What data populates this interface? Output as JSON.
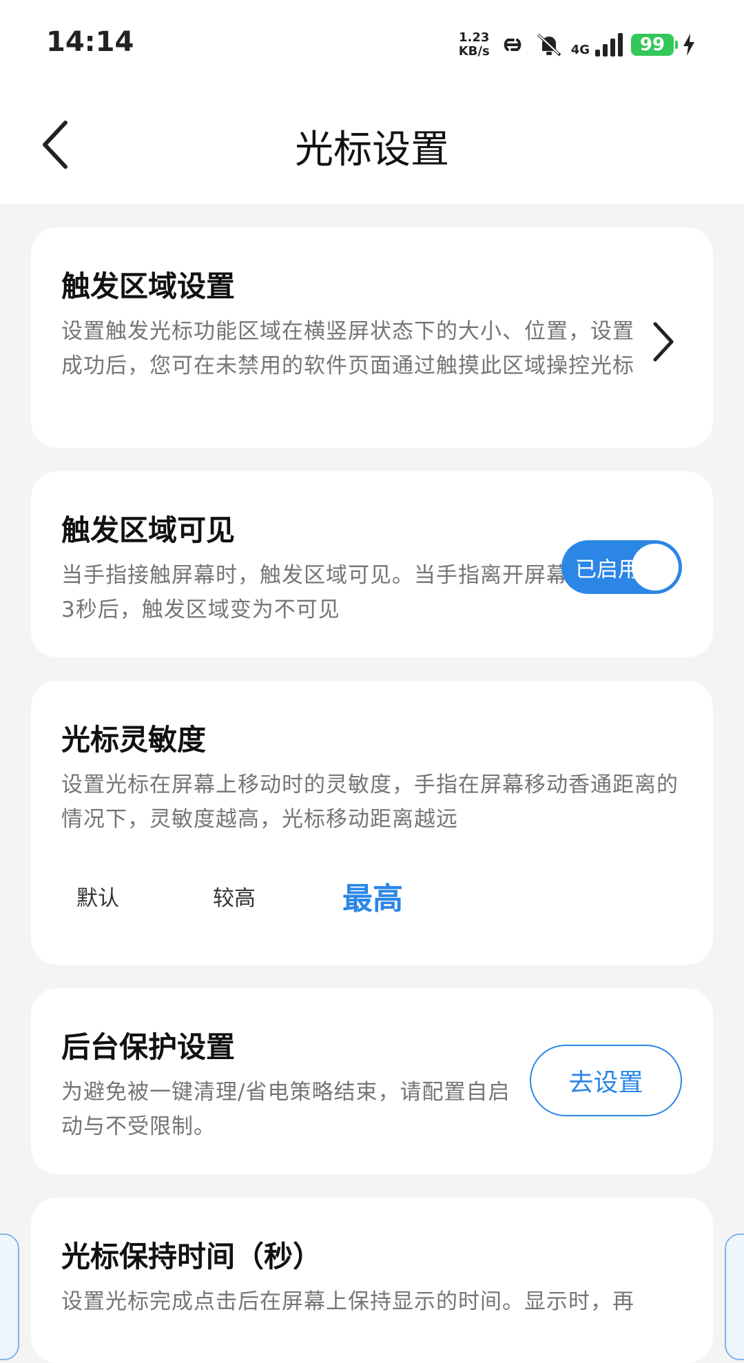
{
  "status": {
    "time": "14:14",
    "net_speed_value": "1.23",
    "net_speed_unit": "KB/s",
    "network_type": "4G",
    "battery": "99"
  },
  "header": {
    "title": "光标设置"
  },
  "cards": {
    "trigger_area": {
      "title": "触发区域设置",
      "desc": "设置触发光标功能区域在横竖屏状态下的大小、位置，设置成功后，您可在未禁用的软件页面通过触摸此区域操控光标"
    },
    "trigger_visible": {
      "title": "触发区域可见",
      "desc": "当手指接触屏幕时，触发区域可见。当手指离开屏幕3秒后，触发区域变为不可见",
      "toggle_label": "已启用"
    },
    "sensitivity": {
      "title": "光标灵敏度",
      "desc": "设置光标在屏幕上移动时的灵敏度，手指在屏幕移动香通距离的情况下，灵敏度越高，光标移动距离越远",
      "options": [
        "默认",
        "较高",
        "最高"
      ],
      "selected": "最高"
    },
    "background_protection": {
      "title": "后台保护设置",
      "desc": "为避免被一键清理/省电策略结束，请配置自启动与不受限制。",
      "button_label": "去设置"
    },
    "hold_time": {
      "title": "光标保持时间（秒）",
      "desc": "设置光标完成点击后在屏幕上保持显示的时间。显示时，再"
    }
  },
  "colors": {
    "accent": "#2b86e6",
    "battery": "#34c759",
    "background": "#f4f4f4"
  },
  "icons": [
    "back-icon",
    "chevron-right-icon",
    "link-icon",
    "bell-muted-icon",
    "signal-icon",
    "battery-icon",
    "charging-icon"
  ]
}
